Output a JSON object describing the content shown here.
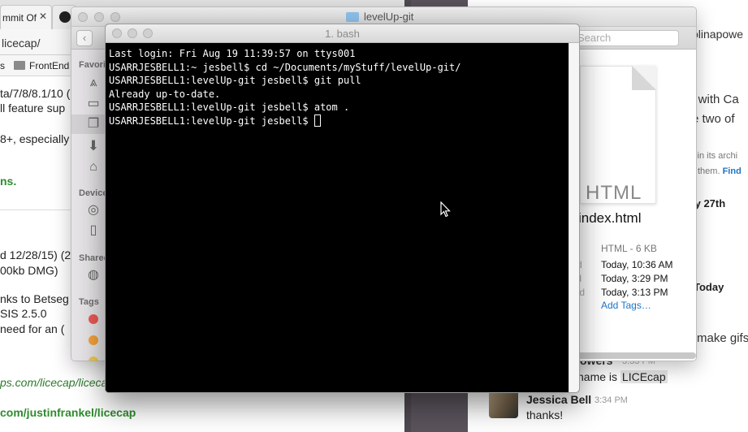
{
  "browser": {
    "tab_title": "mmit Of",
    "tab_close": "✕",
    "url": "licecap/",
    "bookmark_1": "s",
    "bookmark_2": "FrontEnd",
    "lines": [
      "ta/7/8/8.1/10 (",
      "ll feature sup",
      "8+, especially v",
      "ns.",
      "d 12/28/15) (2",
      "00kb DMG)",
      "nks to Betseg",
      "SIS 2.5.0",
      " need for an (",
      "ps.com/licecap/licecap",
      "com/justinfrankel/licecap"
    ]
  },
  "finder": {
    "title": "levelUp-git",
    "back": "‹",
    "search_placeholder": "Search",
    "sidebar_headings": {
      "favorites": "Favorit",
      "devices": "Device",
      "shared": "Shared",
      "tags": "Tags"
    },
    "preview": {
      "doc_label": "HTML",
      "file_name": "index.html",
      "kind_size": "HTML - 6 KB",
      "meta_labels": [
        "ted",
        "ied",
        "ned"
      ],
      "created": "Today, 10:36 AM",
      "modified": "Today, 3:29 PM",
      "opened": "Today, 3:13 PM",
      "add_tags": "Add Tags…"
    },
    "tag_colors": [
      "#ec5a56",
      "#f5a33a",
      "#f4c945"
    ]
  },
  "terminal": {
    "title": "1. bash",
    "lines": [
      "Last login: Fri Aug 19 11:39:57 on ttys001",
      "USARRJESBELL1:~ jesbell$ cd ~/Documents/myStuff/levelUp-git/",
      "USARRJESBELL1:levelUp-git jesbell$ git pull",
      "Already up-to-date.",
      "USARRJESBELL1:levelUp-git jesbell$ atom .",
      "USARRJESBELL1:levelUp-git jesbell$ "
    ]
  },
  "slack": {
    "user": "olinapowe",
    "line_1": "y with Ca",
    "line_2": "e two of",
    "small_1": "s in its archi",
    "small_2": "them.",
    "small_link": "Find",
    "date_1": "ly 27th",
    "date_2": "Today",
    "line_3": "make gifs",
    "prev_sender": "owers",
    "prev_time": "3:33 PM",
    "prev_msg_prefix": "name is ",
    "prev_msg_highlight": "LICEcap",
    "msg_name": "Jessica Bell",
    "msg_time": "3:34 PM",
    "msg_body": "thanks!"
  }
}
